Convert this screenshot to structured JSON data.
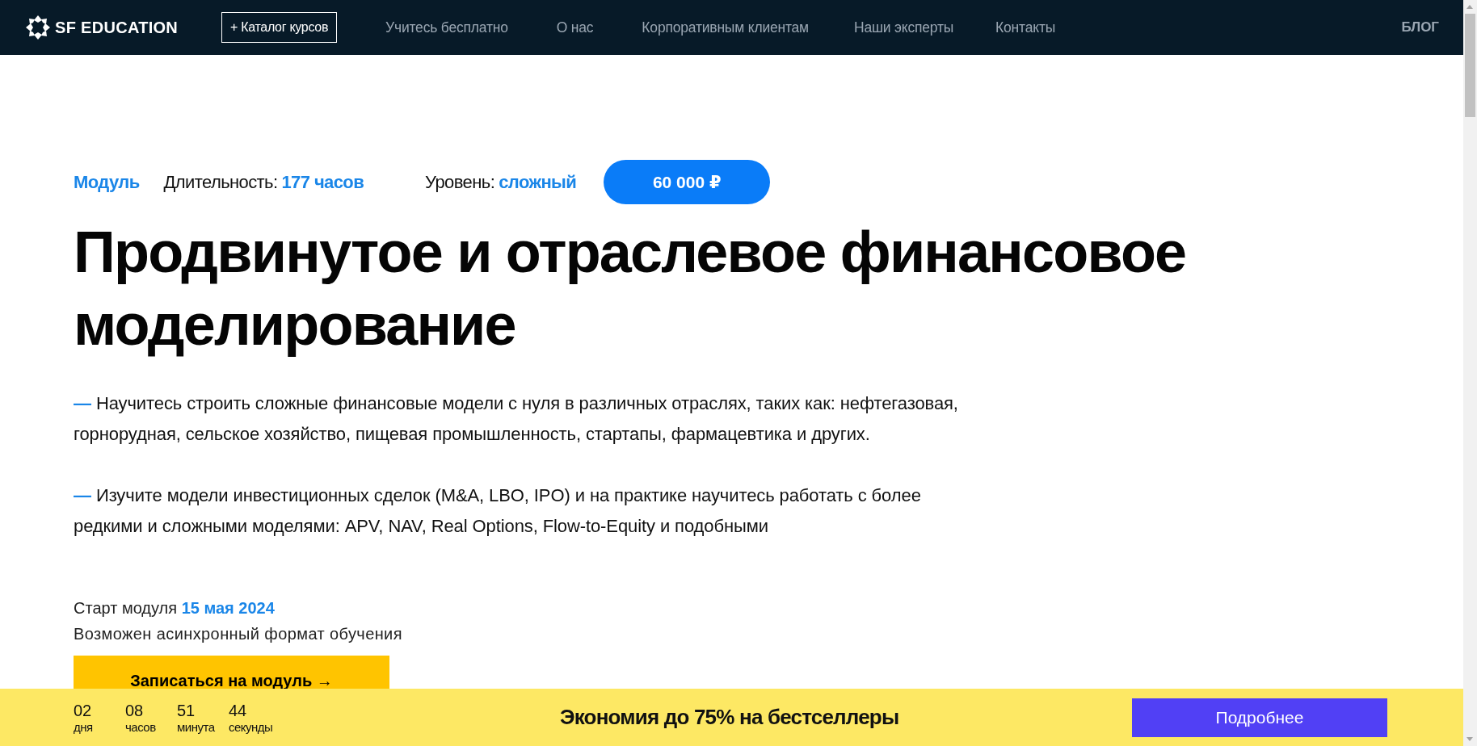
{
  "header": {
    "logo": "SF EDUCATION",
    "catalog_button": "+ Каталог курсов",
    "nav": [
      "Учитесь бесплатно",
      "О нас",
      "Корпоративным клиентам",
      "Наши эксперты",
      "Контакты"
    ],
    "blog": "БЛОГ"
  },
  "course": {
    "type": "Модуль",
    "duration_label": "Длительность:",
    "duration": "177 часов",
    "level_label": "Уровень:",
    "level": "сложный",
    "price": "60 000 ₽",
    "title": "Продвинутое и отраслевое финансовое моделирование",
    "bullets": [
      "Научитесь строить сложные финансовые модели с нуля в различных отраслях, таких как: нефтегазовая, горнорудная, сельское хозяйство, пищевая промышленность, стартапы, фармацевтика и других.",
      "Изучите модели инвестиционных сделок (M&A, LBO, IPO) и на практике научитесь работать с более редкими и сложными моделями: APV, NAV, Real Options, Flow-to-Equity и подобными"
    ],
    "bullet_mark": "—",
    "start_label": "Старт модуля",
    "start_date": "15 мая 2024",
    "format_note": "Возможен асинхронный формат обучения",
    "enroll_button": "Записаться на модуль →"
  },
  "promo_bar": {
    "countdown": [
      {
        "value": "02",
        "unit": "дня"
      },
      {
        "value": "08",
        "unit": "часов"
      },
      {
        "value": "51",
        "unit": "минута"
      },
      {
        "value": "44",
        "unit": "секунды"
      }
    ],
    "text": "Экономия до 75% на бестселлеры",
    "button": "Подробнее"
  }
}
